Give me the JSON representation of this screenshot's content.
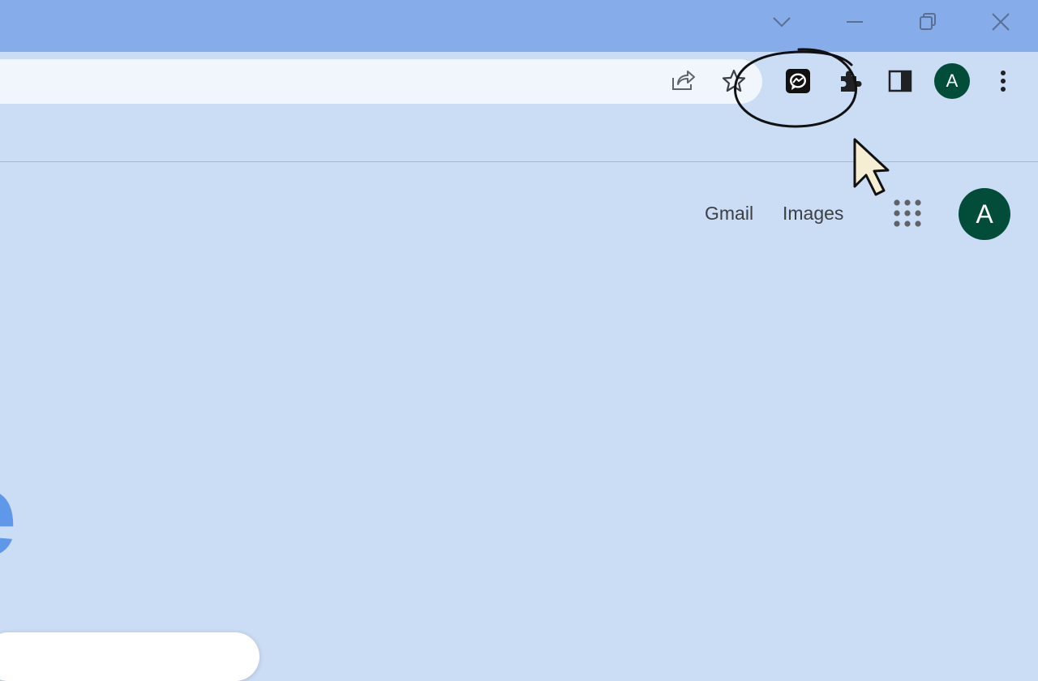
{
  "window": {
    "controls": [
      "tab-search",
      "minimize",
      "restore",
      "close"
    ]
  },
  "toolbar": {
    "icons": [
      "share-icon",
      "bookmark-star-icon",
      "messenger-extension-icon",
      "extensions-puzzle-icon",
      "side-panel-icon",
      "profile-avatar",
      "menu-kebab-icon"
    ],
    "profile_initial": "A"
  },
  "header": {
    "gmail_label": "Gmail",
    "images_label": "Images",
    "avatar_initial": "A"
  },
  "logo": {
    "visible_letter": "e",
    "color": "#5f97ea"
  },
  "colors": {
    "titlebar": "#86adea",
    "background": "#cbdcf5",
    "avatar": "#014d3a"
  }
}
